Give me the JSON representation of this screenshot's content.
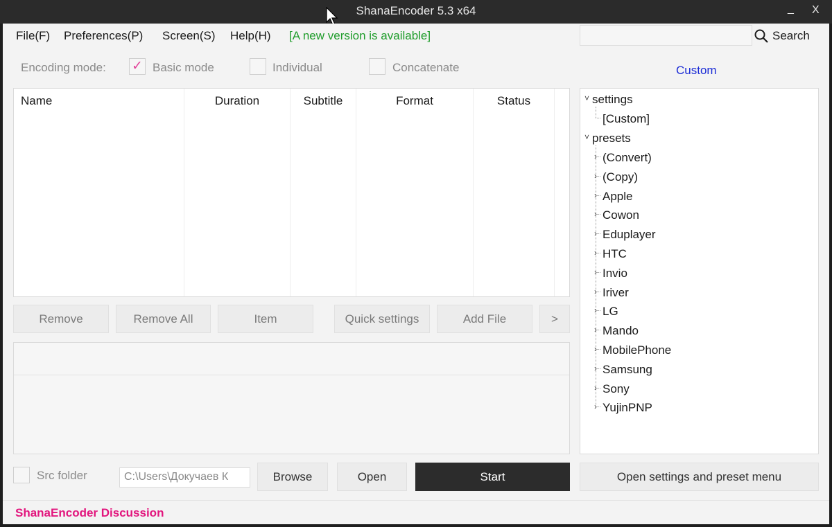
{
  "window": {
    "title": "ShanaEncoder 5.3 x64",
    "minimize": "_",
    "close": "X"
  },
  "menu": {
    "file": "File(F)",
    "preferences": "Preferences(P)",
    "screen": "Screen(S)",
    "help": "Help(H)",
    "new_version": "[A new version is available]"
  },
  "search": {
    "value": "",
    "label": "Search"
  },
  "encoding": {
    "label": "Encoding mode:",
    "basic": "Basic mode",
    "basic_checked": true,
    "individual": "Individual",
    "concatenate": "Concatenate"
  },
  "custom_label": "Custom",
  "filelist": {
    "columns": [
      "Name",
      "Duration",
      "Subtitle",
      "Format",
      "Status"
    ]
  },
  "buttons": {
    "remove": "Remove",
    "remove_all": "Remove All",
    "item": "Item",
    "quick_settings": "Quick settings",
    "add_file": "Add File",
    "more": ">"
  },
  "tree": {
    "settings": "settings",
    "settings_children": [
      "[Custom]"
    ],
    "presets": "presets",
    "preset_children": [
      "(Convert)",
      "(Copy)",
      "Apple",
      "Cowon",
      "Eduplayer",
      "HTC",
      "Invio",
      "Iriver",
      "LG",
      "Mando",
      "MobilePhone",
      "Samsung",
      "Sony",
      "YujinPNP"
    ]
  },
  "bottom": {
    "src_folder": "Src folder",
    "path": "C:\\Users\\Докучаев К",
    "browse": "Browse",
    "open": "Open",
    "start": "Start",
    "open_settings": "Open settings and preset menu"
  },
  "footer": {
    "discussion": "ShanaEncoder Discussion"
  },
  "colors": {
    "accent_pink": "#e2157d",
    "new_version_green": "#1e9c2a",
    "custom_blue": "#1a2bd6",
    "start_bg": "#2c2c2c"
  }
}
